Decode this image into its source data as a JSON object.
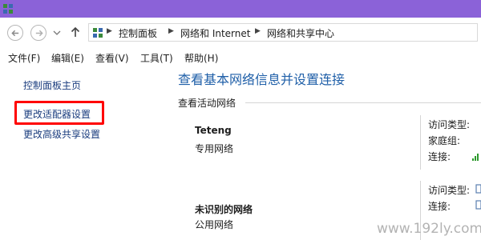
{
  "address": {
    "crumbs": [
      "控制面板",
      "网络和 Internet",
      "网络和共享中心"
    ]
  },
  "menu": {
    "items": [
      "文件(F)",
      "编辑(E)",
      "查看(V)",
      "工具(T)",
      "帮助(H)"
    ]
  },
  "left_pane": {
    "links": [
      "控制面板主页",
      "更改适配器设置",
      "更改高级共享设置"
    ],
    "highlighted_index": 1
  },
  "main": {
    "heading": "查看基本网络信息并设置连接",
    "section_label": "查看活动网络",
    "networks": [
      {
        "name": "Teteng",
        "type": "专用网络",
        "properties": [
          "访问类型:",
          "家庭组:",
          "连接:"
        ]
      },
      {
        "name": "未识别的网络",
        "type": "公用网络",
        "properties": [
          "访问类型:",
          "连接:"
        ]
      }
    ]
  },
  "watermark": "www.192ly.com",
  "colors": {
    "title_strip": "#8b62d8",
    "link": "#1a3c7e",
    "heading": "#1f5fa8",
    "highlight": "#ff0000"
  },
  "icons": [
    "network-window-icon",
    "back-arrow-icon",
    "forward-arrow-icon",
    "history-dropdown-icon",
    "up-arrow-icon",
    "control-panel-icon",
    "breadcrumb-chevron-icon",
    "signal-bars-icon",
    "connection-icon"
  ]
}
